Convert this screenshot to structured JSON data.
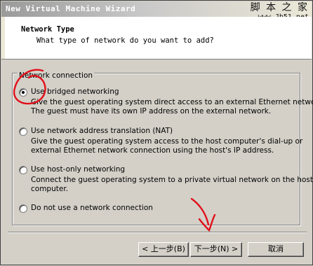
{
  "window": {
    "title": "New Virtual Machine Wizard",
    "watermark_cn": "脚 本 之 家",
    "watermark_url": "www.Jb51.net"
  },
  "header": {
    "title": "Network Type",
    "subtitle": "What type of network do you want to add?"
  },
  "group": {
    "label": "Network connection",
    "options": [
      {
        "label": "Use bridged networking",
        "selected": true,
        "description": [
          "Give the guest operating system direct access to an external Ethernet network.",
          "The guest must have its own IP address on the external network."
        ]
      },
      {
        "label": "Use network address translation (NAT)",
        "selected": false,
        "description": [
          "Give the guest operating system access to the host computer's dial-up or",
          "external Ethernet network connection using the host's IP address."
        ]
      },
      {
        "label": "Use host-only networking",
        "selected": false,
        "description": [
          "Connect the guest operating system to a private virtual network on the host",
          "computer."
        ]
      },
      {
        "label": "Do not use a network connection",
        "selected": false,
        "description": []
      }
    ]
  },
  "buttons": {
    "back": "< 上一步(B)",
    "next": "下一步(N) >",
    "cancel": "取消"
  },
  "annotation_color": "#e0101a"
}
